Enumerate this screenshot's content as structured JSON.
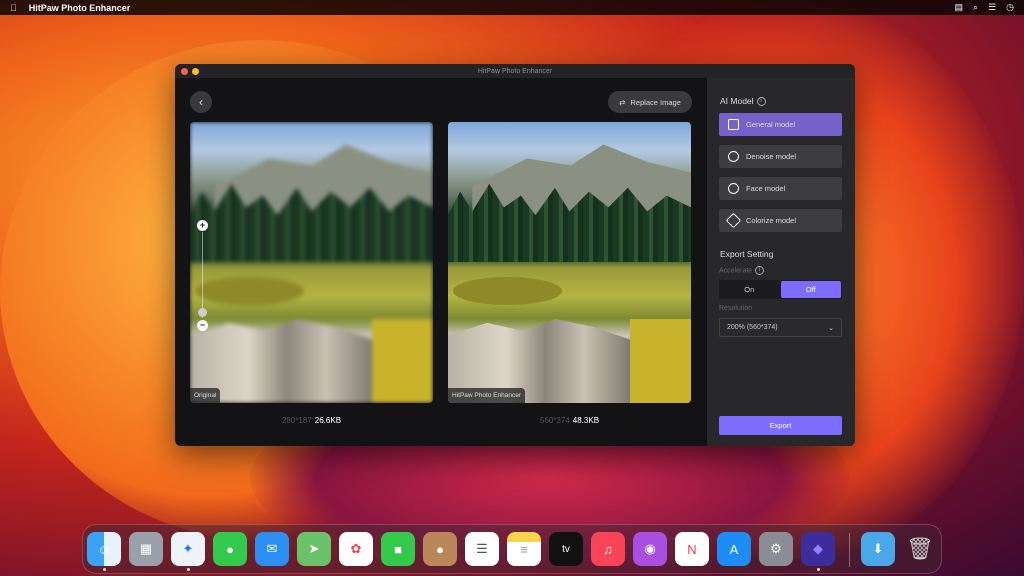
{
  "menubar": {
    "app_name": "HitPaw Photo Enhancer"
  },
  "window": {
    "title": "HitPaw Photo Enhancer"
  },
  "main": {
    "replace_label": "Replace Image",
    "original": {
      "label": "Original",
      "dimensions": "280*187",
      "size": "26.6KB"
    },
    "enhanced": {
      "label": "HitPaw Photo Enhancer",
      "dimensions": "560*374",
      "size": "48.3KB"
    }
  },
  "sidebar": {
    "ai_model_title": "AI Model",
    "models": [
      {
        "label": "General model",
        "active": true
      },
      {
        "label": "Denoise model"
      },
      {
        "label": "Face model"
      },
      {
        "label": "Colorize model"
      }
    ],
    "export_title": "Export Setting",
    "accelerate_label": "Accelerate",
    "accelerate_on": "On",
    "accelerate_off": "Off",
    "accelerate_selected": "Off",
    "resolution_label": "Resolution",
    "resolution_value": "200% (560*374)",
    "export_label": "Export"
  },
  "colors": {
    "accent": "#7d6cff",
    "active_model": "#7461c9"
  },
  "dock": [
    "finder",
    "launchpad",
    "safari",
    "messages",
    "mail",
    "maps",
    "photos",
    "facetime",
    "contacts",
    "reminders",
    "notes",
    "tv",
    "music",
    "podcasts",
    "news",
    "app-store",
    "system-preferences",
    "hitpaw",
    "downloads",
    "trash"
  ]
}
